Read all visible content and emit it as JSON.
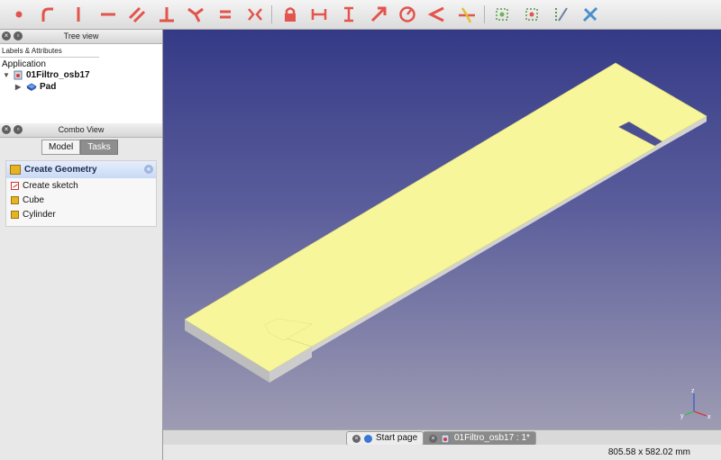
{
  "toolbar": {
    "icons": [
      "point-icon",
      "arc-icon",
      "vertical-line-icon",
      "horizontal-line-icon",
      "parallel-icon",
      "perpendicular-icon",
      "tangent-icon",
      "equal-icon",
      "symmetric-icon",
      "lock-icon",
      "horizontal-distance-icon",
      "vertical-distance-icon",
      "length-icon",
      "radius-icon",
      "angle-icon",
      "snell-icon",
      "select-constraints-icon",
      "select-conflicting-icon",
      "toggle-reference-icon",
      "clone-icon"
    ]
  },
  "tree_view": {
    "title": "Tree view",
    "column_header": "Labels & Attributes",
    "root": "Application",
    "document": "01Filtro_osb17",
    "object": "Pad"
  },
  "combo_view": {
    "title": "Combo View",
    "tabs": [
      "Model",
      "Tasks"
    ],
    "active_tab": "Tasks",
    "task_header": "Create Geometry",
    "items": [
      "Create sketch",
      "Cube",
      "Cylinder"
    ]
  },
  "bottom_tabs": {
    "start_page": "Start page",
    "document_tab": "01Filtro_osb17 : 1*"
  },
  "status": {
    "dimensions": "805.58 x 582.02 mm"
  },
  "colors": {
    "accent_red": "#e2544c",
    "model_face": "#f8f69a",
    "model_side": "#cfcfcf",
    "viewport_top": "#353a87",
    "viewport_bottom": "#9e9cb3"
  }
}
